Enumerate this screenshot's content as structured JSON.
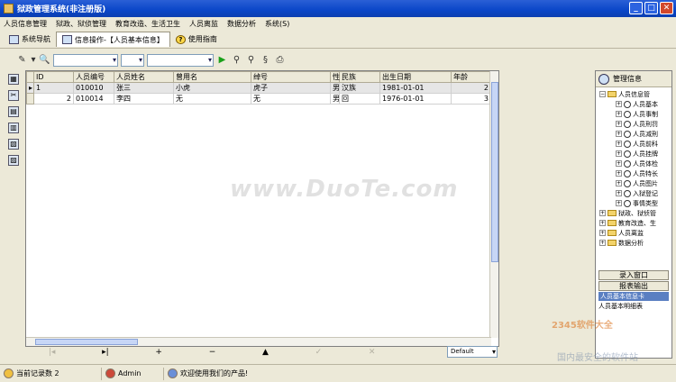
{
  "window": {
    "title": "狱政管理系统(非注册版)"
  },
  "menu": [
    "人员信息管理",
    "狱政、狱侦管理",
    "教育改造、生活卫生",
    "人员离监",
    "数据分析",
    "系统(S)"
  ],
  "tabs": [
    {
      "label": "系统导航"
    },
    {
      "label": "信息操作-【人员基本信息】"
    },
    {
      "label": "使用指南"
    }
  ],
  "table": {
    "columns": [
      "ID",
      "人员编号",
      "人员姓名",
      "曾用名",
      "绰号",
      "性",
      "民族",
      "出生日期",
      "年龄"
    ],
    "rows": [
      {
        "id": "1",
        "code": "010010",
        "name": "张三",
        "alias": "小虎",
        "nick": "虎子",
        "sex": "男",
        "nation": "汉族",
        "birth": "1981-01-01",
        "age": "2"
      },
      {
        "id": "2",
        "code": "010014",
        "name": "李四",
        "alias": "无",
        "nick": "无",
        "sex": "男",
        "nation": "回",
        "birth": "1976-01-01",
        "age": "3"
      }
    ]
  },
  "nav": {
    "first": "|◂",
    "prev": "▸|",
    "add": "+",
    "del": "−",
    "up": "▲",
    "check": "✓",
    "x": "✕",
    "style": "Default"
  },
  "right_panel": {
    "title": "管理信息",
    "tree": [
      {
        "label": "人员信息管",
        "level": 0,
        "type": "folder",
        "expanded": true
      },
      {
        "label": "人员基本",
        "level": 1,
        "type": "doc"
      },
      {
        "label": "人员事制",
        "level": 1,
        "type": "doc"
      },
      {
        "label": "人员刑罚",
        "level": 1,
        "type": "doc"
      },
      {
        "label": "人员减刑",
        "level": 1,
        "type": "doc"
      },
      {
        "label": "人员前科",
        "level": 1,
        "type": "doc"
      },
      {
        "label": "人员挂牌",
        "level": 1,
        "type": "doc"
      },
      {
        "label": "人员体检",
        "level": 1,
        "type": "doc"
      },
      {
        "label": "人员特长",
        "level": 1,
        "type": "doc"
      },
      {
        "label": "人员图片",
        "level": 1,
        "type": "doc"
      },
      {
        "label": "入狱登记",
        "level": 1,
        "type": "doc"
      },
      {
        "label": "事情类型",
        "level": 1,
        "type": "doc"
      },
      {
        "label": "狱政、狱侦管",
        "level": 0,
        "type": "folder"
      },
      {
        "label": "教育改造、生",
        "level": 0,
        "type": "folder"
      },
      {
        "label": "人员离监",
        "level": 0,
        "type": "folder"
      },
      {
        "label": "数据分析",
        "level": 0,
        "type": "folder"
      }
    ],
    "buttons": [
      "录入窗口",
      "报表输出"
    ],
    "subitems": [
      "人员基本信息卡",
      "人员基本明细表"
    ]
  },
  "status": {
    "records": "当前记录数 2",
    "user": "Admin",
    "welcome": "欢迎使用我们的产品!"
  },
  "watermark": {
    "main": "www.DuoTe.com",
    "brand": "2345软件大全",
    "sub": "国内最安全的软件站"
  }
}
